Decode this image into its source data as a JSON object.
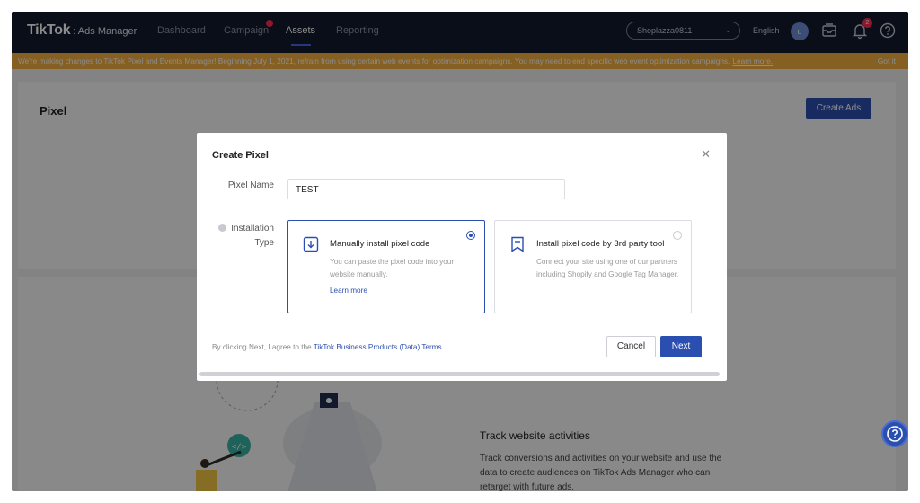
{
  "nav": {
    "logo_main": "TikTok",
    "logo_sub": ": Ads Manager",
    "items": [
      {
        "label": "Dashboard"
      },
      {
        "label": "Campaign"
      },
      {
        "label": "Assets"
      },
      {
        "label": "Reporting"
      }
    ],
    "active_item": "Assets",
    "account": "Shoplazza0811",
    "language": "English",
    "avatar_initial": "u",
    "notification_count": "2",
    "icons": [
      "inbox-icon",
      "bell-icon",
      "help-circle-icon"
    ]
  },
  "banner": {
    "text": "We're making changes to TikTok Pixel and Events Manager! Beginning July 1, 2021, refrain from using certain web events for optimization campaigns. You may need to end specific web event optimization campaigns.",
    "link": "Learn more.",
    "dismiss": "Got it",
    "color": "#f5ad3f"
  },
  "page": {
    "title": "Pixel",
    "create_ads": "Create Ads",
    "track_title": "Track website activities",
    "track_desc": "Track conversions and activities on your website and use the data to create audiences on TikTok Ads Manager who can retarget with future ads."
  },
  "modal": {
    "title": "Create Pixel",
    "pixel_name_label": "Pixel Name",
    "pixel_name_value": "TEST",
    "installation_label": "Installation Type",
    "options": [
      {
        "title": "Manually install pixel code",
        "desc": "You can paste the pixel code into your website manually.",
        "link": "Learn more",
        "selected": true
      },
      {
        "title": "Install pixel code by 3rd party tool",
        "desc": "Connect your site using one of our partners including Shopify and Google Tag Manager.",
        "selected": false
      }
    ],
    "agree_prefix": "By clicking Next, I agree to the",
    "agree_link": "TikTok Business Products (Data) Terms",
    "cancel": "Cancel",
    "next": "Next"
  },
  "colors": {
    "primary": "#2b4fb0",
    "nav_bg": "#111a2c",
    "badge": "#fe2c55"
  }
}
